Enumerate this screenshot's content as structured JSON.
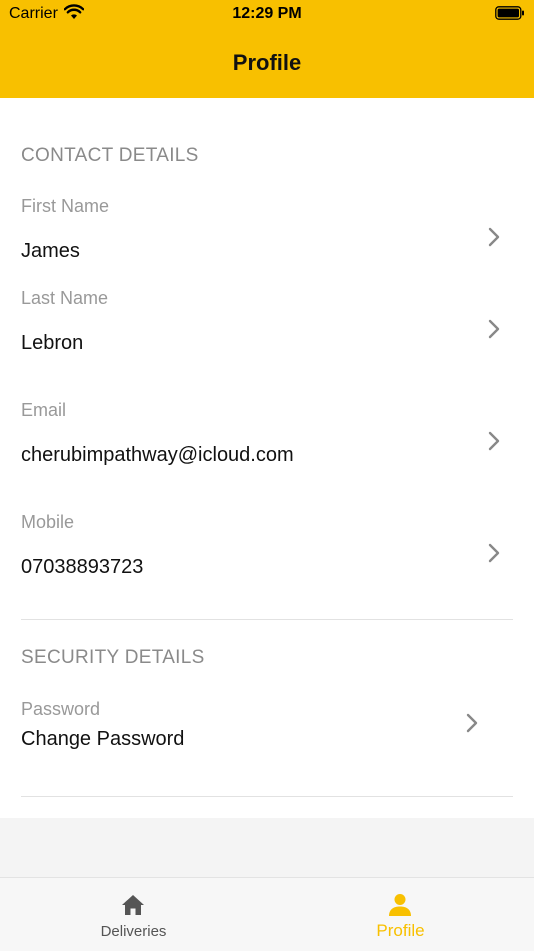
{
  "status_bar": {
    "carrier": "Carrier",
    "time": "12:29 PM"
  },
  "header": {
    "title": "Profile",
    "color": "#f8c000"
  },
  "contact": {
    "section_title": "CONTACT DETAILS",
    "first_name_label": "First Name",
    "first_name_value": "James",
    "last_name_label": "Last Name",
    "last_name_value": "Lebron",
    "email_label": "Email",
    "email_value": "cherubimpathway@icloud.com",
    "mobile_label": "Mobile",
    "mobile_value": "07038893723"
  },
  "security": {
    "section_title": "SECURITY DETAILS",
    "password_label": "Password",
    "password_value": "Change Password"
  },
  "tabbar": {
    "tabs": [
      {
        "label": "Deliveries",
        "icon": "home-icon",
        "active": false
      },
      {
        "label": "Profile",
        "icon": "person-icon",
        "active": true
      }
    ],
    "active_color": "#f8c000",
    "inactive_color": "#555555"
  }
}
